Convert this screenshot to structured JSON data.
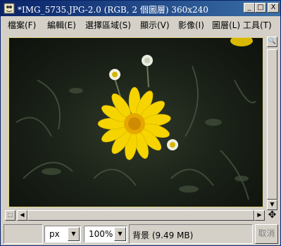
{
  "window": {
    "title": "*IMG_5735.JPG-2.0 (RGB, 2 個圖層) 360x240",
    "minimize_label": "_",
    "maximize_label": "□",
    "close_label": "X"
  },
  "menubar": {
    "items": [
      {
        "label": "檔案(F)"
      },
      {
        "label": "編輯(E)"
      },
      {
        "label": "選擇區域(S)"
      },
      {
        "label": "顯示(V)"
      },
      {
        "label": "影像(I)"
      },
      {
        "label": "圖層(L)"
      },
      {
        "label": "工具(T)"
      }
    ]
  },
  "statusbar": {
    "unit": "px",
    "zoom": "100%",
    "layer_info": "背景 (9.49 MB)",
    "cancel_label": "取消"
  },
  "icons": {
    "app": "wilber-icon",
    "navigate": "magnifier-icon",
    "quick_mask": "quick-mask-icon",
    "move": "four-way-arrow-icon"
  },
  "colors": {
    "titlebar_start": "#0a246a",
    "titlebar_end": "#3a6ea5",
    "selection_border": "#e3d04a",
    "petal": "#f5d400",
    "flower_center": "#e6a800"
  }
}
